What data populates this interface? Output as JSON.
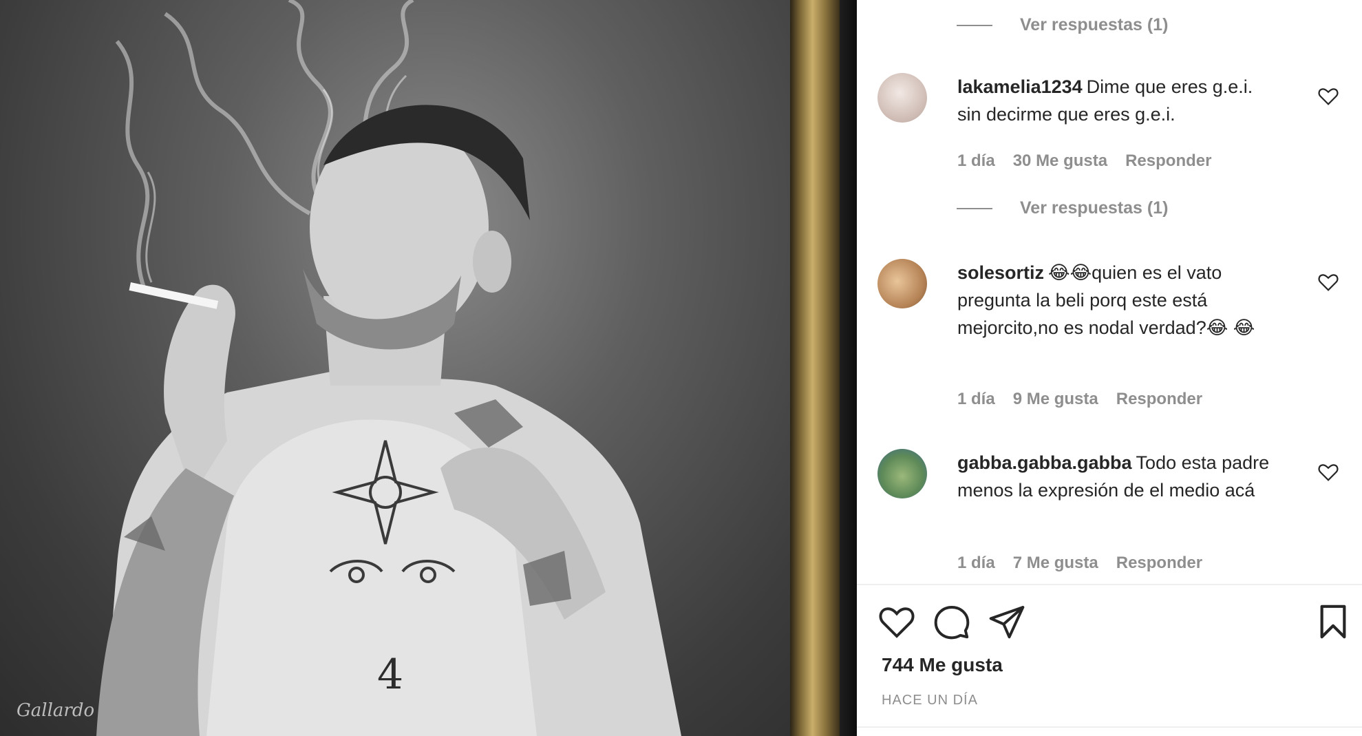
{
  "post": {
    "image_alt": "Painting of a tattooed man smoking a cigarette",
    "artist_signature": "Gallardo"
  },
  "comments": [
    {
      "view_replies": "Ver respuestas (1)"
    },
    {
      "username": "lakamelia1234",
      "text": "Dime que eres g.e.i. sin decirme que eres g.e.i.",
      "time": "1 día",
      "likes": "30 Me gusta",
      "reply": "Responder",
      "view_replies": "Ver respuestas (1)",
      "avatar_color": "#d8c9c2"
    },
    {
      "username": "solesortiz",
      "text": "😂😂quien es el vato pregunta la beli porq este está mejorcito,no es nodal verdad?😂 😂",
      "time": "1 día",
      "likes": "9 Me gusta",
      "reply": "Responder",
      "avatar_color": "#c49a6c"
    },
    {
      "username": "gabba.gabba.gabba",
      "text": "Todo esta padre menos la expresión de el medio acá",
      "time": "1 día",
      "likes": "7 Me gusta",
      "reply": "Responder",
      "avatar_color": "#6a8f5a"
    }
  ],
  "actions": {
    "like_icon": "heart-outline-icon",
    "comment_icon": "speech-bubble-icon",
    "share_icon": "paper-plane-icon",
    "save_icon": "bookmark-icon"
  },
  "likes_count": "744 Me gusta",
  "post_time": "HACE UN DÍA",
  "colors": {
    "text": "#262626",
    "muted": "#8e8e8e",
    "divider": "#efefef"
  }
}
